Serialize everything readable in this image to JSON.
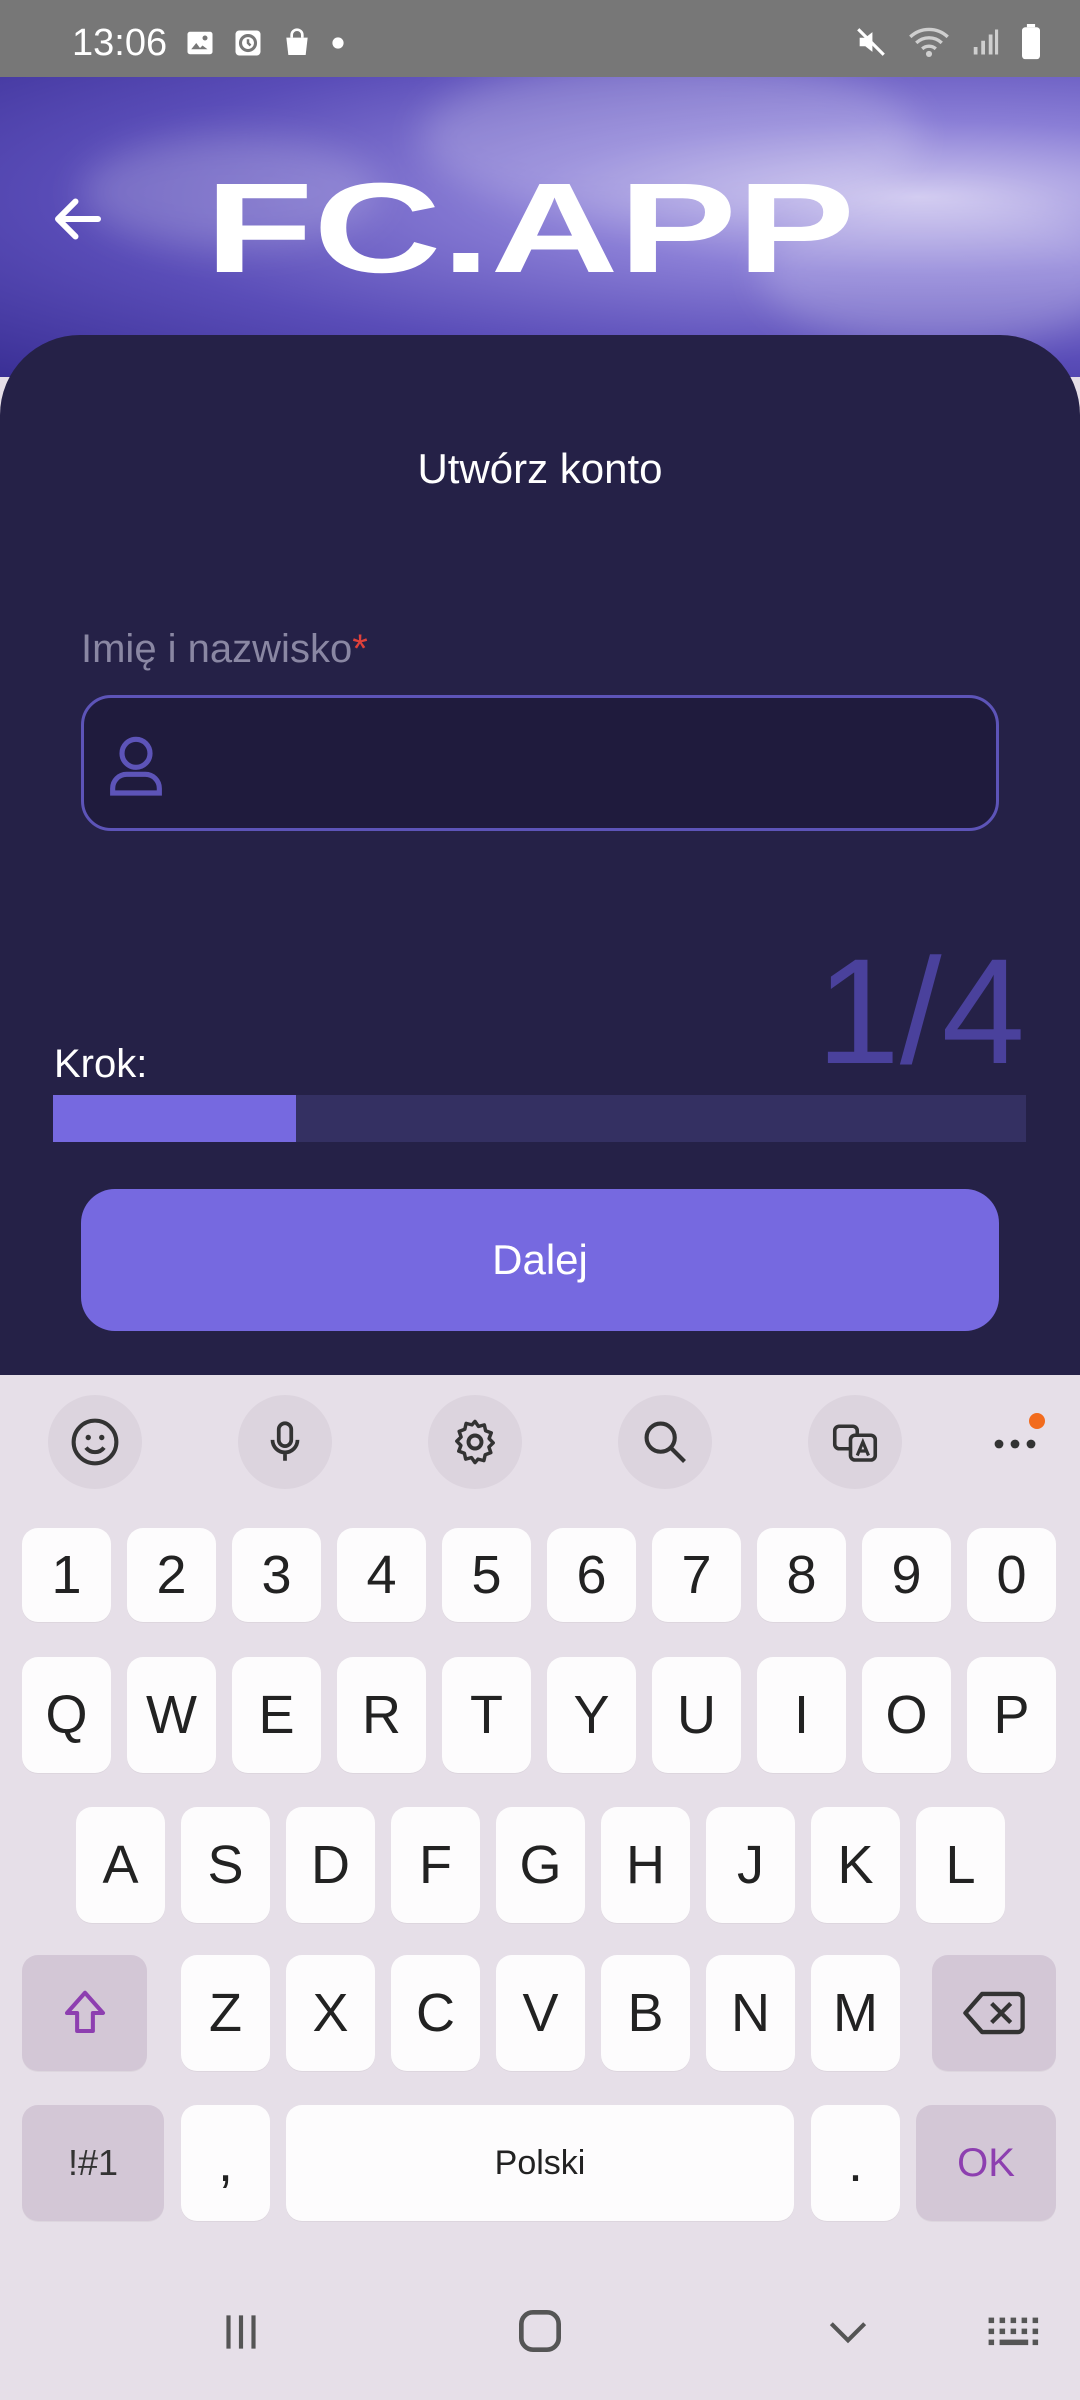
{
  "status_bar": {
    "time": "13:06"
  },
  "header": {
    "logo_text": "FC.APP"
  },
  "form": {
    "title": "Utwórz konto",
    "name_label": "Imię i nazwisko",
    "required_mark": "*",
    "name_value": "",
    "step_label": "Krok:",
    "step_counter": "1/4",
    "progress_fraction": 0.25,
    "next_button": "Dalej"
  },
  "keyboard": {
    "number_row": [
      "1",
      "2",
      "3",
      "4",
      "5",
      "6",
      "7",
      "8",
      "9",
      "0"
    ],
    "row1": [
      "Q",
      "W",
      "E",
      "R",
      "T",
      "Y",
      "U",
      "I",
      "O",
      "P"
    ],
    "row2": [
      "A",
      "S",
      "D",
      "F",
      "G",
      "H",
      "J",
      "K",
      "L"
    ],
    "row3": [
      "Z",
      "X",
      "C",
      "V",
      "B",
      "N",
      "M"
    ],
    "symbols_key": "!#1",
    "comma_key": ",",
    "space_label": "Polski",
    "period_key": ".",
    "ok_key": "OK"
  },
  "colors": {
    "card_bg": "#252147",
    "accent": "#7669e0",
    "progress_track": "#343062",
    "ok_text": "#8d3fb0",
    "notification_dot": "#f26b1d"
  }
}
